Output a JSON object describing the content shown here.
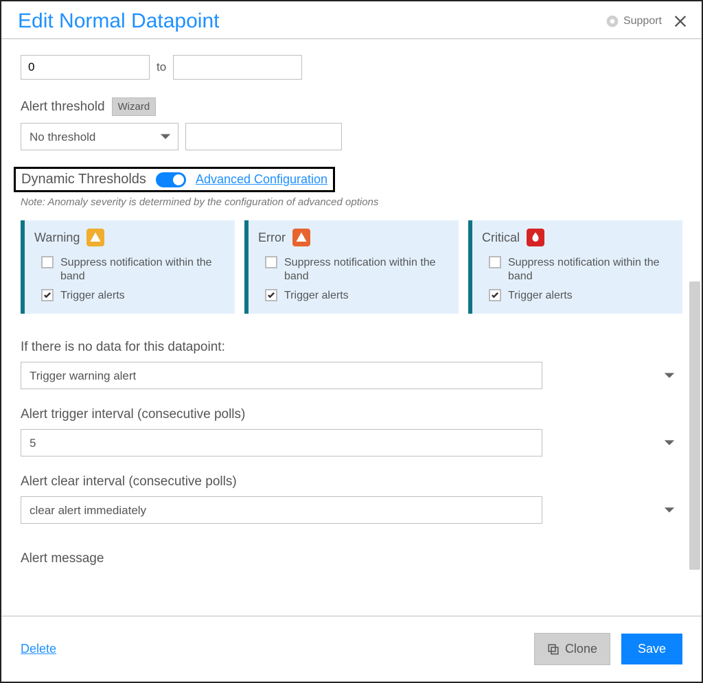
{
  "header": {
    "title": "Edit Normal Datapoint",
    "support": "Support"
  },
  "range": {
    "from_value": "0",
    "to_label": "to",
    "to_value": ""
  },
  "alert_threshold": {
    "label": "Alert threshold",
    "wizard": "Wizard",
    "select_value": "No threshold",
    "expr_value": ""
  },
  "dynamic": {
    "label": "Dynamic Thresholds",
    "enabled": true,
    "advanced": "Advanced Configuration",
    "note": "Note: Anomaly severity is determined by the configuration of advanced options"
  },
  "cards": [
    {
      "title": "Warning",
      "suppress_label": "Suppress notification within the band",
      "suppress": false,
      "trigger_label": "Trigger alerts",
      "trigger": true
    },
    {
      "title": "Error",
      "suppress_label": "Suppress notification within the band",
      "suppress": false,
      "trigger_label": "Trigger alerts",
      "trigger": true
    },
    {
      "title": "Critical",
      "suppress_label": "Suppress notification within the band",
      "suppress": false,
      "trigger_label": "Trigger alerts",
      "trigger": true
    }
  ],
  "no_data": {
    "label": "If there is no data for this datapoint:",
    "value": "Trigger warning alert"
  },
  "trigger_interval": {
    "label": "Alert trigger interval (consecutive polls)",
    "value": "5"
  },
  "clear_interval": {
    "label": "Alert clear interval (consecutive polls)",
    "value": "clear alert immediately"
  },
  "alert_message_label": "Alert message",
  "footer": {
    "delete": "Delete",
    "clone": "Clone",
    "save": "Save"
  }
}
